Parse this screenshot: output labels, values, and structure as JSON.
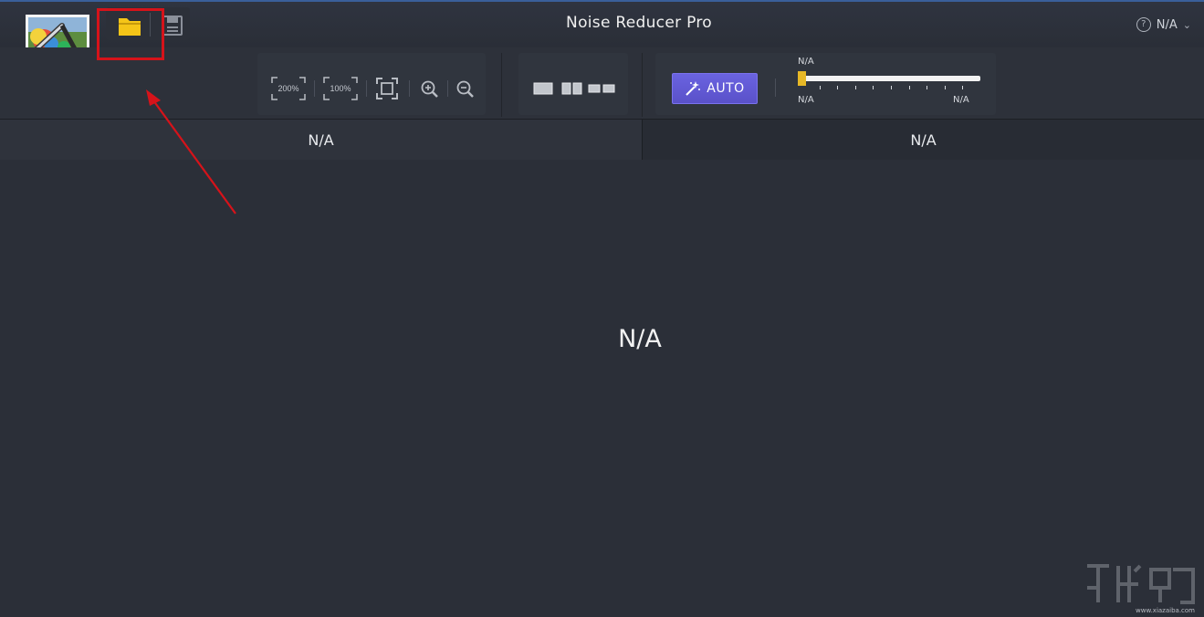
{
  "window": {
    "title": "Noise Reducer Pro",
    "help_label": "N/A",
    "help_chevron": "⌄"
  },
  "toolbar": {
    "zoom_200": "200%",
    "zoom_100": "100%",
    "auto_label": "AUTO",
    "slider": {
      "top_label": "N/A",
      "left_label": "N/A",
      "right_label": "N/A",
      "value_fraction": 0.0
    }
  },
  "compare": {
    "left_label": "N/A",
    "right_label": "N/A"
  },
  "canvas": {
    "message": "N/A"
  },
  "watermark": {
    "text": "www.xiazaiba.com"
  },
  "colors": {
    "accent_purple": "#5a51c9",
    "highlight_red": "#d6131a",
    "folder_yellow": "#f5c518",
    "slider_thumb": "#e7b826"
  },
  "icons": [
    "app-logo-icon",
    "folder-open-icon",
    "save-icon",
    "help-icon",
    "zoom-200-icon",
    "zoom-100-icon",
    "fit-screen-icon",
    "zoom-in-icon",
    "zoom-out-icon",
    "single-view-icon",
    "split-view-icon",
    "side-by-side-icon",
    "magic-wand-icon"
  ]
}
